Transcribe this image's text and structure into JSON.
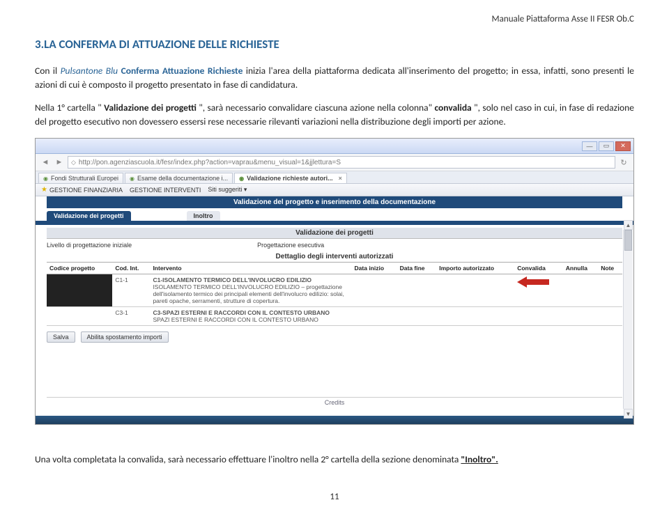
{
  "header_right": "Manuale Piattaforma Asse II FESR Ob.C",
  "section_title": "3.LA CONFERMA DI ATTUAZIONE DELLE RICHIESTE",
  "para1_a": "Con il ",
  "para1_b": "Pulsantone Blu",
  "para1_c": "Conferma Attuazione Richieste",
  "para1_d": " inizia l'area della piattaforma dedicata all'inserimento del progetto; in essa, infatti, sono presenti le azioni di cui è composto il progetto presentato in fase di candidatura.",
  "para2_a": "Nella 1° cartella \"",
  "para2_b": "Validazione dei progetti",
  "para2_c": "\", sarà necessario convalidare ciascuna azione nella colonna\" ",
  "para2_d": "convalida",
  "para2_e": "\", solo nel caso in cui, in fase di redazione del progetto esecutivo non dovessero essersi rese necessarie rilevanti variazioni nella distribuzione degli importi per azione.",
  "browser": {
    "url": "http://pon.agenziascuola.it/fesr/index.php?action=vaprau&menu_visual=1&jjlettura=S",
    "tabs": [
      {
        "label": "Fondi Strutturali Europei"
      },
      {
        "label": "Esame della documentazione i..."
      },
      {
        "label": "Validazione richieste autori..."
      }
    ],
    "toolbar": {
      "gf": "GESTIONE FINANZIARIA",
      "gi": "GESTIONE INTERVENTI",
      "siti": "Siti suggeriti ▾"
    },
    "banner1": "Validazione del progetto e inserimento della documentazione",
    "folder_active": "Validazione dei progetti",
    "folder_inactive": "Inoltro",
    "banner2": "Validazione dei progetti",
    "sub_left": "Livello di progettazione iniziale",
    "sub_right": "Progettazione esecutiva",
    "dett_title": "Dettaglio degli interventi autorizzati",
    "columns": {
      "c1": "Codice progetto",
      "c2": "Cod. Int.",
      "c3": "Intervento",
      "c4": "Data inizio",
      "c5": "Data fine",
      "c6": "Importo autorizzato",
      "c7": "Convalida",
      "c8": "Annulla",
      "c9": "Note"
    },
    "rows": [
      {
        "cod": "C1-1",
        "title": "C1-ISOLAMENTO TERMICO DELL'INVOLUCRO EDILIZIO",
        "desc": "ISOLAMENTO TERMICO DELL'INVOLUCRO EDILIZIO – progettazione dell'isolamento termico dei principali elementi dell'involucro edilizio: solai, pareti opache, serramenti, strutture di copertura."
      },
      {
        "cod": "C3-1",
        "title": "C3-SPAZI ESTERNI E RACCORDI CON IL CONTESTO URBANO",
        "desc": "SPAZI ESTERNI E RACCORDI CON IL CONTESTO URBANO"
      }
    ],
    "btn_salva": "Salva",
    "btn_abilita": "Abilita spostamento importi",
    "credits": "Credits"
  },
  "para3_a": "Una volta completata la convalida, sarà necessario effettuare l'inoltro nella 2° cartella della sezione denominata ",
  "para3_b": "\"Inoltro\".",
  "page_num": "11"
}
